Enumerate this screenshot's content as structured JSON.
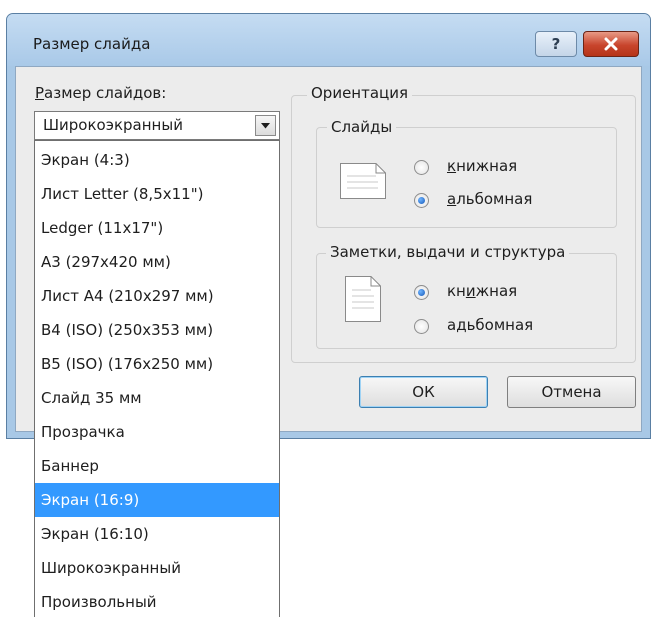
{
  "window": {
    "title": "Размер слайда",
    "help_label": "?"
  },
  "size": {
    "label_prefix": "Р",
    "label_rest": "азмер слайдов:",
    "selected": "Широкоэкранный",
    "options": [
      "Экран (4:3)",
      "Лист Letter (8,5x11\")",
      "Ledger (11x17\")",
      "A3 (297x420 мм)",
      "Лист A4 (210x297 мм)",
      "B4 (ISO) (250x353 мм)",
      "B5 (ISO) (176x250 мм)",
      "Слайд 35 мм",
      "Прозрачка",
      "Баннер",
      "Экран (16:9)",
      "Экран (16:10)",
      "Широкоэкранный",
      "Произвольный"
    ],
    "highlighted_option": "Экран (16:9)"
  },
  "orientation": {
    "title": "Ориентация",
    "slides": {
      "title": "Слайды",
      "portrait_underline": "к",
      "portrait_rest": "нижная",
      "landscape_underline": "а",
      "landscape_rest": "льбомная",
      "selected": "landscape"
    },
    "notes": {
      "title": "Заметки, выдачи и структура",
      "portrait_pre": "кн",
      "portrait_underline": "и",
      "portrait_rest": "жная",
      "landscape_pre": "а",
      "landscape_underline": "д",
      "landscape_rest": "ьбомная",
      "selected": "portrait"
    }
  },
  "buttons": {
    "ok": "ОК",
    "cancel": "Отмена"
  },
  "colors": {
    "selection": "#3399ff",
    "title_bar": "#a9c9e8",
    "close_button": "#c8452d"
  }
}
